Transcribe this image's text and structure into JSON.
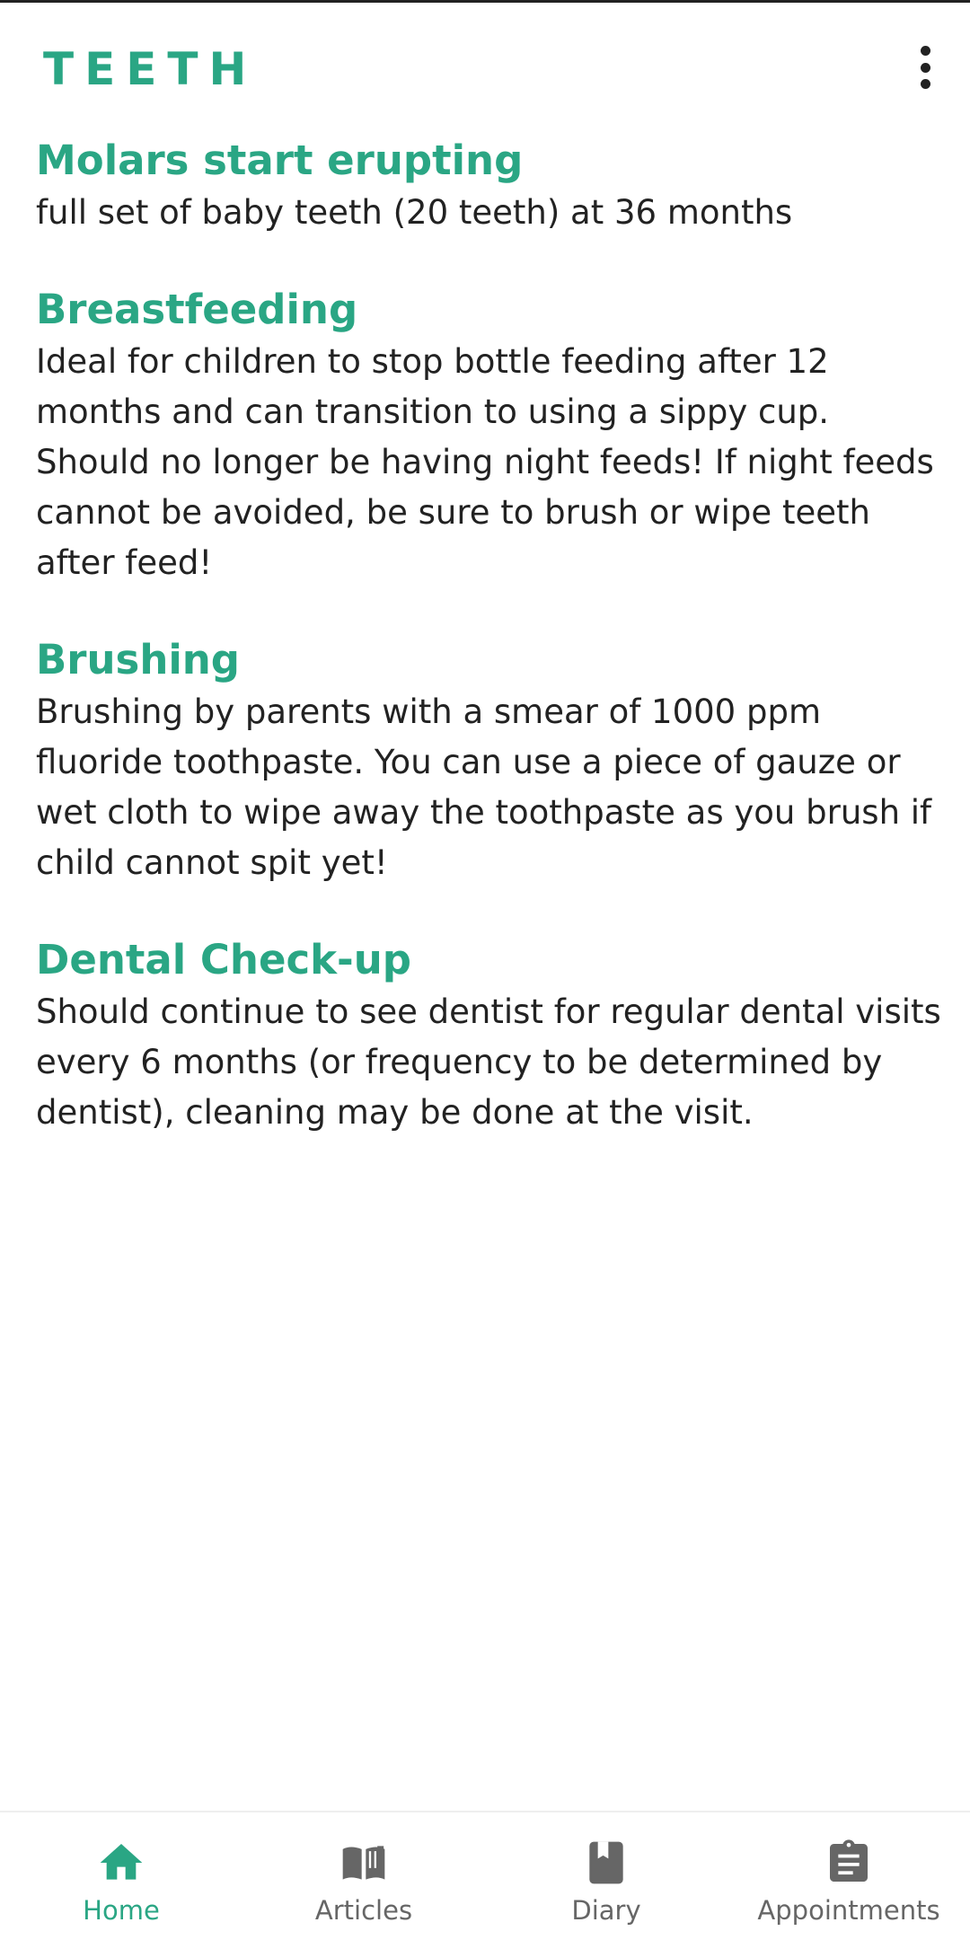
{
  "colors": {
    "accent": "#2aa684",
    "text": "#222222",
    "nav_inactive": "#666666"
  },
  "app_bar": {
    "title": "TEETH",
    "menu_icon": "more-vert-icon"
  },
  "sections": [
    {
      "heading": "Molars start erupting",
      "body": "full set of baby teeth (20 teeth) at 36 months"
    },
    {
      "heading": "Breastfeeding",
      "body": "Ideal for children to stop bottle feeding after 12 months and can transition to using a sippy cup. Should no longer be having night feeds! If night feeds cannot be avoided, be sure to brush  or wipe teeth after feed!"
    },
    {
      "heading": "Brushing",
      "body": "Brushing by parents with a smear of 1000 ppm fluoride toothpaste. You can use a piece of gauze or wet cloth to wipe away the toothpaste as you brush if child cannot spit yet!"
    },
    {
      "heading": "Dental Check-up",
      "body": "Should continue to see dentist for regular dental visits every 6 months (or frequency to be determined by dentist), cleaning may be done at the visit."
    }
  ],
  "bottom_nav": {
    "selected": "Home",
    "items": [
      {
        "label": "Home",
        "icon": "home-icon"
      },
      {
        "label": "Articles",
        "icon": "book-icon"
      },
      {
        "label": "Diary",
        "icon": "bookmark-book-icon"
      },
      {
        "label": "Appointments",
        "icon": "clipboard-icon"
      }
    ]
  }
}
